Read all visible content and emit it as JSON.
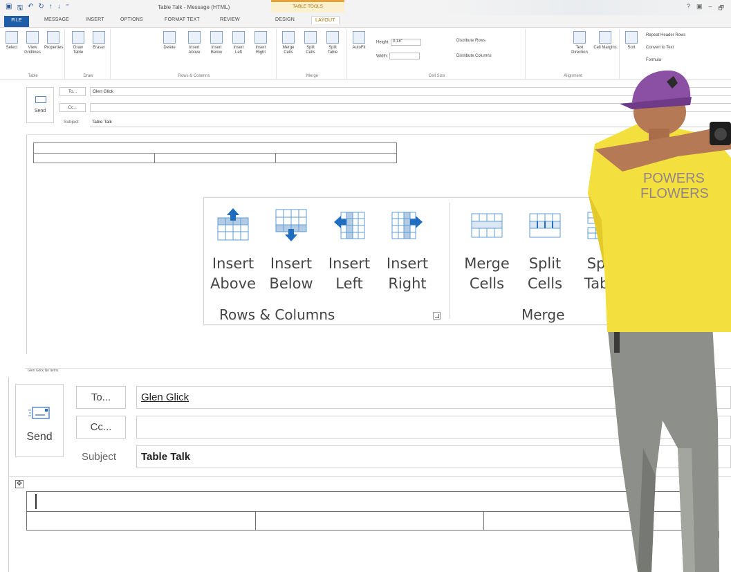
{
  "window": {
    "title": "Table Talk - Message (HTML)",
    "context_group": "TABLE TOOLS",
    "controls": [
      "?",
      "▣",
      "–",
      "🗗"
    ]
  },
  "tabs": [
    {
      "label": "FILE"
    },
    {
      "label": "MESSAGE"
    },
    {
      "label": "INSERT"
    },
    {
      "label": "OPTIONS"
    },
    {
      "label": "FORMAT TEXT"
    },
    {
      "label": "REVIEW"
    },
    {
      "label": "DESIGN"
    },
    {
      "label": "LAYOUT"
    }
  ],
  "ribbon": {
    "table_group": {
      "name": "Table",
      "buttons": [
        "Select",
        "View Gridlines",
        "Properties"
      ]
    },
    "draw_group": {
      "name": "Draw",
      "buttons": [
        "Draw Table",
        "Eraser"
      ]
    },
    "rows_group": {
      "name": "Rows & Columns",
      "buttons": [
        "Delete",
        "Insert Above",
        "Insert Below",
        "Insert Left",
        "Insert Right"
      ]
    },
    "merge_group": {
      "name": "Merge",
      "buttons": [
        "Merge Cells",
        "Split Cells",
        "Split Table"
      ]
    },
    "cellsize_group": {
      "name": "Cell Size",
      "autofit": "AutoFit",
      "height_label": "Height:",
      "height_value": "0.18\"",
      "width_label": "Width:",
      "width_value": "",
      "distribute_rows": "Distribute Rows",
      "distribute_columns": "Distribute Columns"
    },
    "alignment_group": {
      "name": "Alignment",
      "buttons": [
        "Text Direction",
        "Cell Margins"
      ]
    },
    "data_group": {
      "sort": "Sort",
      "repeat": "Repeat Header Rows",
      "convert": "Convert to Text",
      "formula": "Formula"
    }
  },
  "compose_small": {
    "send": "Send",
    "to_btn": "To...",
    "to_value": "Glen Glick",
    "cc_btn": "Cc...",
    "cc_value": "",
    "subject_label": "Subject",
    "subject_value": "Table Talk",
    "status": "Glen Glick  No Items"
  },
  "zoom_panel": {
    "rows_columns": {
      "group_name": "Rows & Columns",
      "buttons": [
        {
          "line1": "Insert",
          "line2": "Above",
          "icon": "insert-above-icon"
        },
        {
          "line1": "Insert",
          "line2": "Below",
          "icon": "insert-below-icon"
        },
        {
          "line1": "Insert",
          "line2": "Left",
          "icon": "insert-left-icon"
        },
        {
          "line1": "Insert",
          "line2": "Right",
          "icon": "insert-right-icon"
        }
      ]
    },
    "merge": {
      "group_name": "Merge",
      "buttons": [
        {
          "line1": "Merge",
          "line2": "Cells",
          "icon": "merge-cells-icon"
        },
        {
          "line1": "Split",
          "line2": "Cells",
          "icon": "split-cells-icon"
        },
        {
          "line1": "Split",
          "line2": "Table",
          "icon": "split-table-icon"
        }
      ]
    }
  },
  "compose_zoom": {
    "send": "Send",
    "to_btn": "To...",
    "to_value": "Glen Glick",
    "cc_btn": "Cc...",
    "cc_value": "",
    "subject_label": "Subject",
    "subject_value": "Table Talk"
  },
  "colors": {
    "accent_blue": "#2b579a",
    "file_tab": "#1c5ea8",
    "context_orange": "#e8a33c",
    "icon_blue": "#5b9bd5",
    "shirt_yellow": "#f3df3e",
    "cap_purple": "#8b4fa3"
  }
}
